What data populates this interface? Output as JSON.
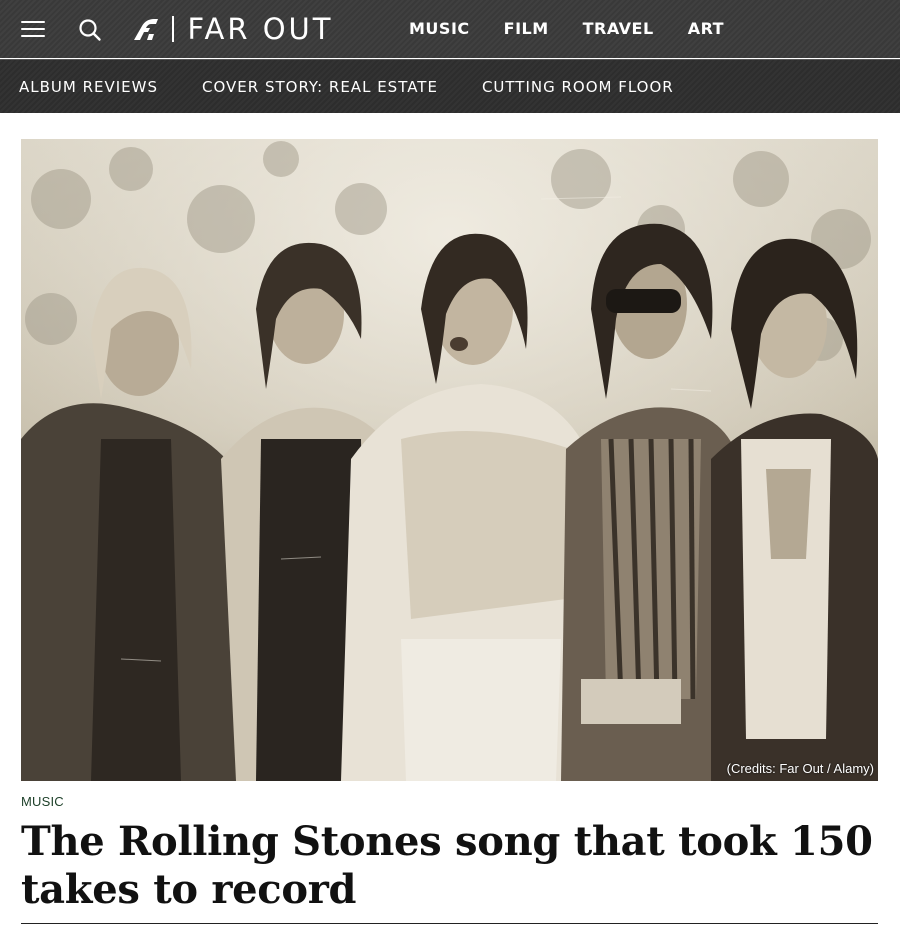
{
  "header": {
    "logo_text": "FAR OUT",
    "main_nav": [
      "MUSIC",
      "FILM",
      "TRAVEL",
      "ART"
    ]
  },
  "sub_nav": [
    "ALBUM REVIEWS",
    "COVER STORY: REAL ESTATE",
    "CUTTING ROOM FLOOR"
  ],
  "article": {
    "image_credit": "(Credits: Far Out / Alamy)",
    "category": "MUSIC",
    "headline": "The Rolling Stones song that took 150 takes to record"
  },
  "colors": {
    "header_bg": "#3b3b3b",
    "subnav_bg": "#2e2e2e",
    "category": "#1c3f28"
  },
  "icons": [
    "hamburger-menu-icon",
    "search-icon",
    "far-out-logo-mark"
  ]
}
